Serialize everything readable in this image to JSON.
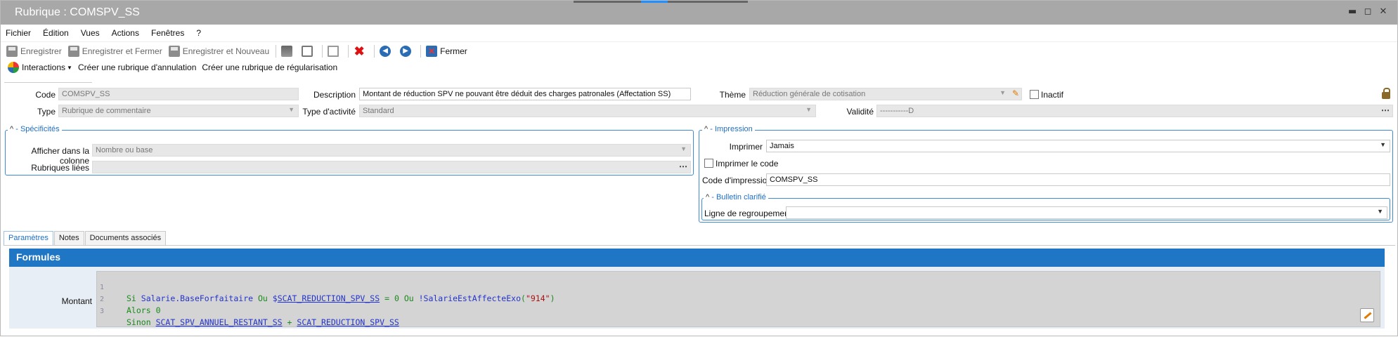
{
  "window": {
    "title": "Rubrique : COMSPV_SS",
    "controls": {
      "minimize": "▬",
      "maximize": "◻",
      "close": "✕"
    }
  },
  "menu": [
    "Fichier",
    "Édition",
    "Vues",
    "Actions",
    "Fenêtres",
    "?"
  ],
  "toolbar": {
    "save": "Enregistrer",
    "save_close": "Enregistrer et Fermer",
    "save_new": "Enregistrer et Nouveau",
    "close": "Fermer"
  },
  "actions": {
    "interactions": "Interactions",
    "cancel_rubric": "Créer une rubrique d'annulation",
    "regul_rubric": "Créer une rubrique de régularisation"
  },
  "form": {
    "code_label": "Code",
    "code_value": "COMSPV_SS",
    "description_label": "Description",
    "description_value": "Montant de réduction SPV ne pouvant être déduit des charges patronales (Affectation SS)",
    "theme_label": "Thème",
    "theme_value": "Réduction générale de cotisation",
    "inactif_label": "Inactif",
    "type_label": "Type",
    "type_value": "Rubrique de commentaire",
    "activity_label": "Type d'activité",
    "activity_value": "Standard",
    "validity_label": "Validité",
    "validity_value": "-----------D"
  },
  "specificites": {
    "title": "Spécificités",
    "column_label": "Afficher dans la colonne",
    "column_value": "Nombre ou base",
    "linked_label": "Rubriques liées",
    "linked_value": ""
  },
  "impression": {
    "title": "Impression",
    "print_label": "Imprimer",
    "print_value": "Jamais",
    "print_code_label": "Imprimer le code",
    "code_label": "Code d'impression",
    "code_value": "COMSPV_SS"
  },
  "bulletin": {
    "title": "Bulletin clarifié",
    "group_label": "Ligne de regroupement",
    "group_value": ""
  },
  "tabs": [
    "Paramètres",
    "Notes",
    "Documents associés"
  ],
  "formules": {
    "title": "Formules",
    "montant_label": "Montant",
    "line_numbers": [
      "1",
      "2",
      "3"
    ]
  },
  "colors": {
    "accent": "#1f76c5",
    "titlebar": "#a8a8a8",
    "group_border": "#3d8ad6"
  }
}
